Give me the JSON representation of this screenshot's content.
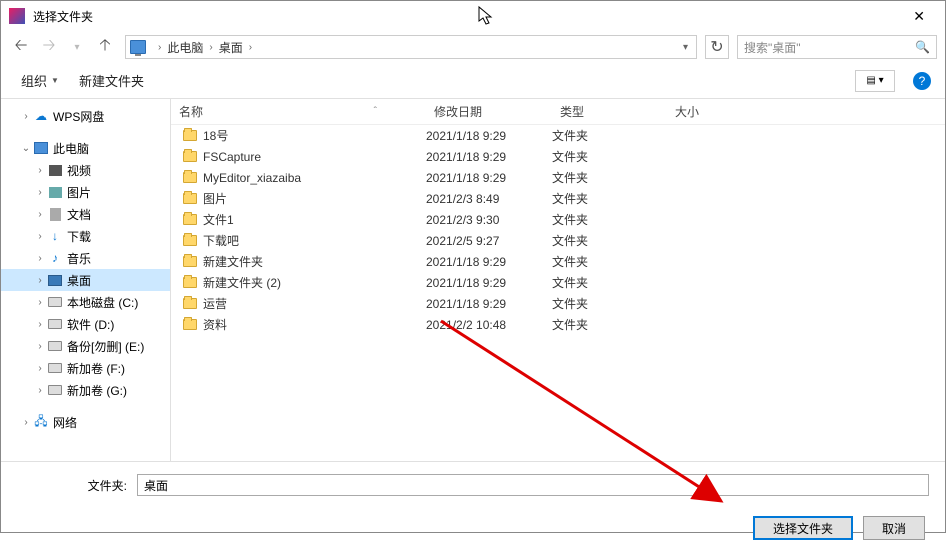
{
  "titlebar": {
    "title": "选择文件夹"
  },
  "breadcrumb": {
    "root": "此电脑",
    "item1": "桌面"
  },
  "search": {
    "placeholder": "搜索\"桌面\""
  },
  "toolbar": {
    "organize": "组织",
    "new_folder": "新建文件夹"
  },
  "tree": {
    "wps": "WPS网盘",
    "pc": "此电脑",
    "video": "视频",
    "pictures": "图片",
    "documents": "文档",
    "downloads": "下载",
    "music": "音乐",
    "desktop": "桌面",
    "drive_c": "本地磁盘 (C:)",
    "drive_d": "软件 (D:)",
    "drive_e": "备份[勿删] (E:)",
    "drive_f": "新加卷 (F:)",
    "drive_g": "新加卷 (G:)",
    "network": "网络"
  },
  "columns": {
    "name": "名称",
    "date": "修改日期",
    "type": "类型",
    "size": "大小"
  },
  "rows": [
    {
      "name": "18号",
      "date": "2021/1/18 9:29",
      "type": "文件夹"
    },
    {
      "name": "FSCapture",
      "date": "2021/1/18 9:29",
      "type": "文件夹"
    },
    {
      "name": "MyEditor_xiazaiba",
      "date": "2021/1/18 9:29",
      "type": "文件夹"
    },
    {
      "name": "图片",
      "date": "2021/2/3 8:49",
      "type": "文件夹"
    },
    {
      "name": "文件1",
      "date": "2021/2/3 9:30",
      "type": "文件夹"
    },
    {
      "name": "下载吧",
      "date": "2021/2/5 9:27",
      "type": "文件夹"
    },
    {
      "name": "新建文件夹",
      "date": "2021/1/18 9:29",
      "type": "文件夹"
    },
    {
      "name": "新建文件夹 (2)",
      "date": "2021/1/18 9:29",
      "type": "文件夹"
    },
    {
      "name": "运营",
      "date": "2021/1/18 9:29",
      "type": "文件夹"
    },
    {
      "name": "资料",
      "date": "2021/2/2 10:48",
      "type": "文件夹"
    }
  ],
  "bottom": {
    "label": "文件夹:",
    "value": "桌面",
    "select": "选择文件夹",
    "cancel": "取消"
  }
}
